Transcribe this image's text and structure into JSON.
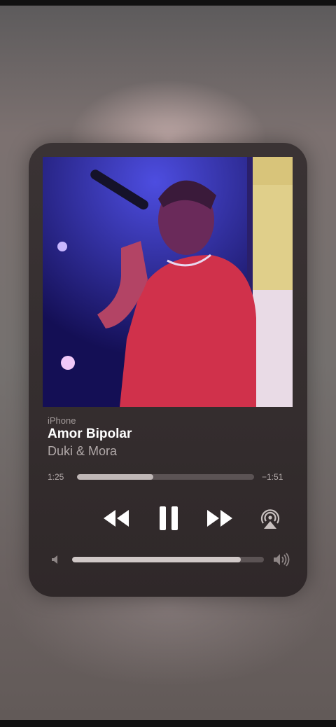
{
  "player": {
    "source": "iPhone",
    "title": "Amor Bipolar",
    "artist": "Duki & Mora",
    "elapsed": "1:25",
    "remaining": "−1:51",
    "progress_fraction": 0.43,
    "volume_fraction": 0.88
  },
  "controls": {
    "rewind_icon": "backward-icon",
    "pause_icon": "pause-icon",
    "forward_icon": "forward-icon",
    "airplay_icon": "airplay-icon",
    "volume_low_icon": "speaker-low-icon",
    "volume_high_icon": "speaker-high-icon"
  },
  "colors": {
    "card": "#362f30",
    "progress_fill": "#bfb7b6",
    "track": "#5b5354",
    "title": "#ffffff"
  }
}
